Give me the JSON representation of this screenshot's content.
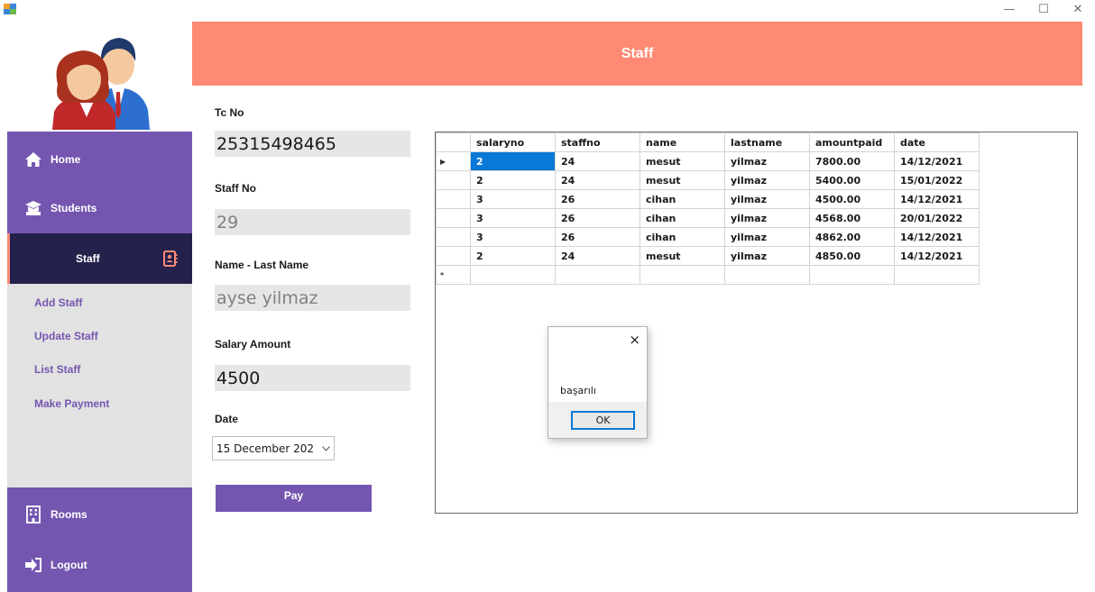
{
  "window": {
    "controls": {
      "minimize": "—",
      "maximize": "☐",
      "close": "✕"
    }
  },
  "sidebar": {
    "nav": [
      {
        "label": "Home",
        "icon": "home-icon"
      },
      {
        "label": "Students",
        "icon": "graduation-cap-icon"
      },
      {
        "label": "Staff",
        "icon": "contact-book-icon",
        "active": true
      },
      {
        "label": "Rooms",
        "icon": "building-icon"
      },
      {
        "label": "Logout",
        "icon": "logout-icon"
      }
    ],
    "submenu": [
      "Add Staff",
      "Update Staff",
      "List Staff",
      "Make Payment"
    ]
  },
  "header": {
    "title": "Staff"
  },
  "form": {
    "tc_label": "Tc No",
    "tc_value": "25315498465",
    "staffno_label": "Staff No",
    "staffno_value": "29",
    "name_label": "Name - Last Name",
    "name_value": "ayse yilmaz",
    "salary_label": "Salary Amount",
    "salary_value": "4500",
    "date_label": "Date",
    "date_value": "15  December  202",
    "pay_label": "Pay"
  },
  "grid": {
    "columns": [
      "salaryno",
      "staffno",
      "name",
      "lastname",
      "amountpaid",
      "date"
    ],
    "rows": [
      [
        "2",
        "24",
        "mesut",
        "yilmaz",
        "7800.00",
        "14/12/2021"
      ],
      [
        "2",
        "24",
        "mesut",
        "yilmaz",
        "5400.00",
        "15/01/2022"
      ],
      [
        "3",
        "26",
        "cihan",
        "yilmaz",
        "4500.00",
        "14/12/2021"
      ],
      [
        "3",
        "26",
        "cihan",
        "yilmaz",
        "4568.00",
        "20/01/2022"
      ],
      [
        "3",
        "26",
        "cihan",
        "yilmaz",
        "4862.00",
        "14/12/2021"
      ],
      [
        "2",
        "24",
        "mesut",
        "yilmaz",
        "4850.00",
        "14/12/2021"
      ]
    ],
    "current_row_marker": "▶",
    "new_row_marker": "*"
  },
  "messagebox": {
    "text": "başarılı",
    "ok_label": "OK",
    "close": "×"
  },
  "colors": {
    "purple": "#7456b0",
    "navy": "#24214d",
    "coral": "#ff8a74",
    "selection": "#0a78d7"
  }
}
